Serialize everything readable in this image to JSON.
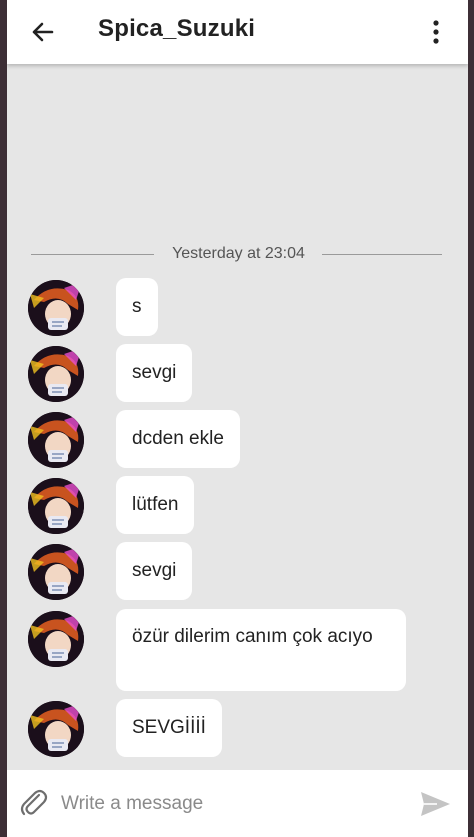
{
  "header": {
    "back_icon": "arrow-left-icon",
    "title": "Spica_Suzuki",
    "menu_icon": "more-vertical-icon"
  },
  "chat": {
    "date_divider": "Yesterday at 23:04",
    "messages": [
      {
        "text": "s"
      },
      {
        "text": "sevgi"
      },
      {
        "text": "dcden ekle"
      },
      {
        "text": "lütfen"
      },
      {
        "text": "sevgi"
      },
      {
        "text": "özür dilerim canım çok acıyo"
      },
      {
        "text": "SEVGİİİİ"
      }
    ]
  },
  "composer": {
    "attach_icon": "paperclip-icon",
    "placeholder": "Write a message",
    "send_icon": "send-icon"
  },
  "colors": {
    "chat_background": "#e6e6e6",
    "bubble": "#ffffff",
    "header": "#ffffff"
  }
}
